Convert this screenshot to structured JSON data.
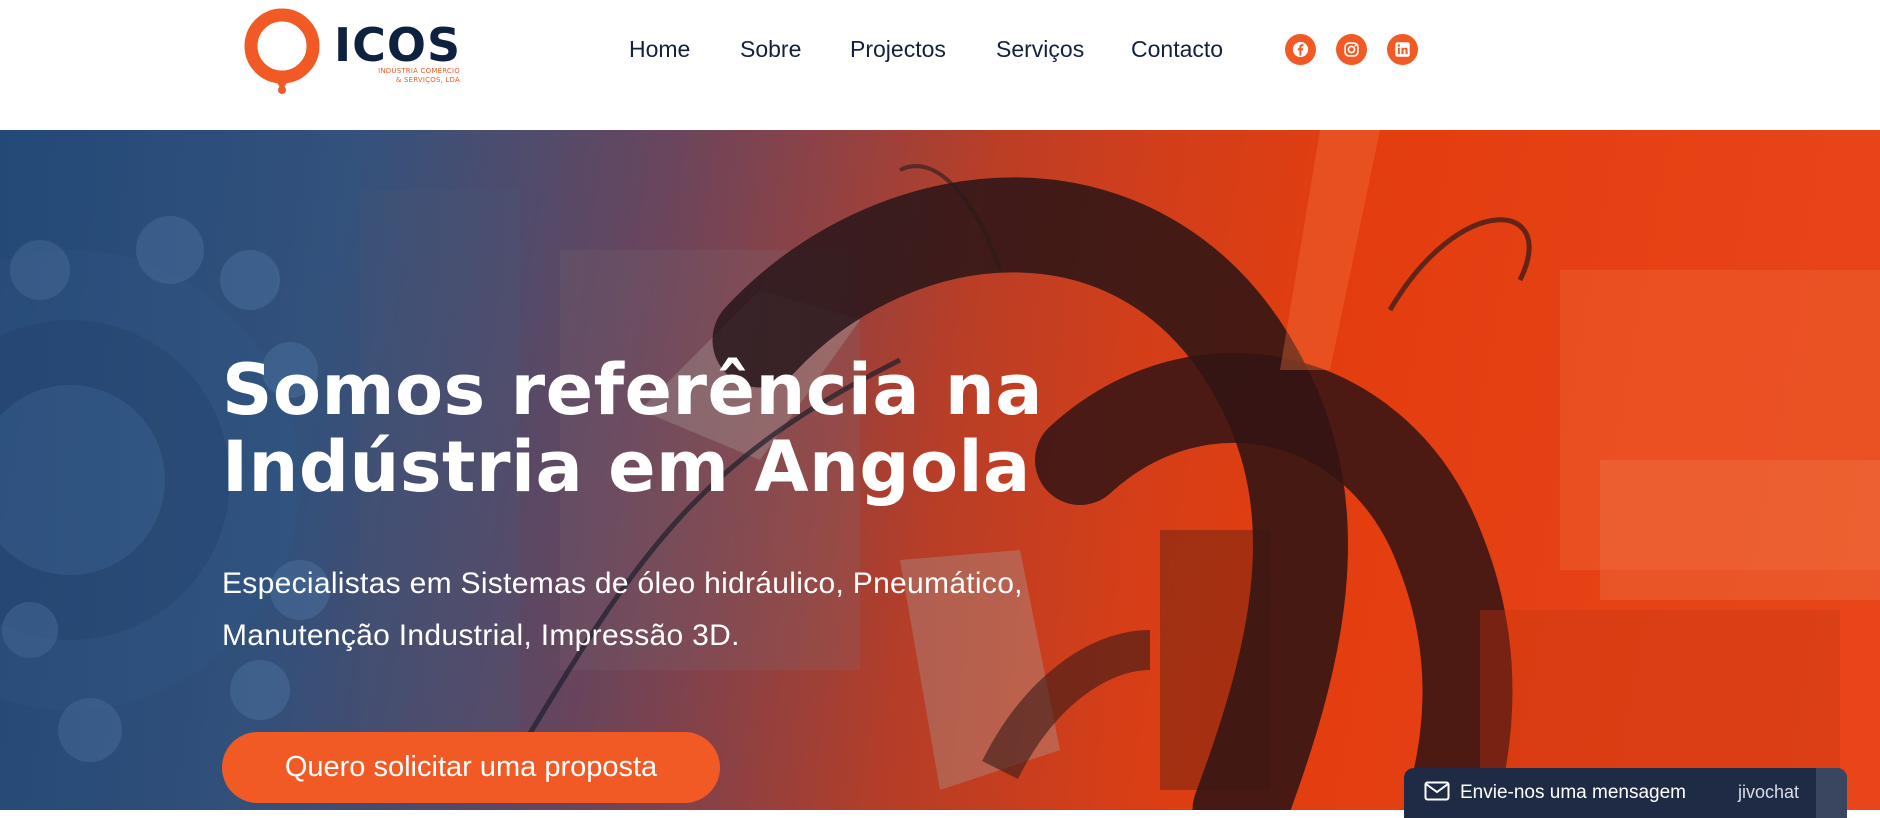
{
  "header": {
    "logo": {
      "word": "ICOS",
      "tagline_line1": "INDÚSTRIA COMÉRCIO",
      "tagline_line2": "& SERVIÇOS, LDA",
      "icon": "drop-ring-logo-icon"
    },
    "nav": [
      "Home",
      "Sobre",
      "Projectos",
      "Serviços",
      "Contacto"
    ],
    "social": [
      {
        "name": "facebook-icon"
      },
      {
        "name": "instagram-icon"
      },
      {
        "name": "linkedin-icon"
      }
    ]
  },
  "hero": {
    "title_line1": "Somos referência na",
    "title_line2": "Indústria em Angola",
    "subtitle_line1": "Especialistas em Sistemas de óleo hidráulico, Pneumático,",
    "subtitle_line2": "Manutenção Industrial, Impressão 3D.",
    "cta_label": "Quero solicitar uma proposta"
  },
  "chat": {
    "label": "Envie-nos uma mensagem",
    "brand": "jivochat",
    "icon": "envelope-icon"
  },
  "colors": {
    "accent": "#f15a24",
    "navy": "#0e2240",
    "nav_text": "#14213d",
    "chat_bg": "#1f2b45"
  }
}
